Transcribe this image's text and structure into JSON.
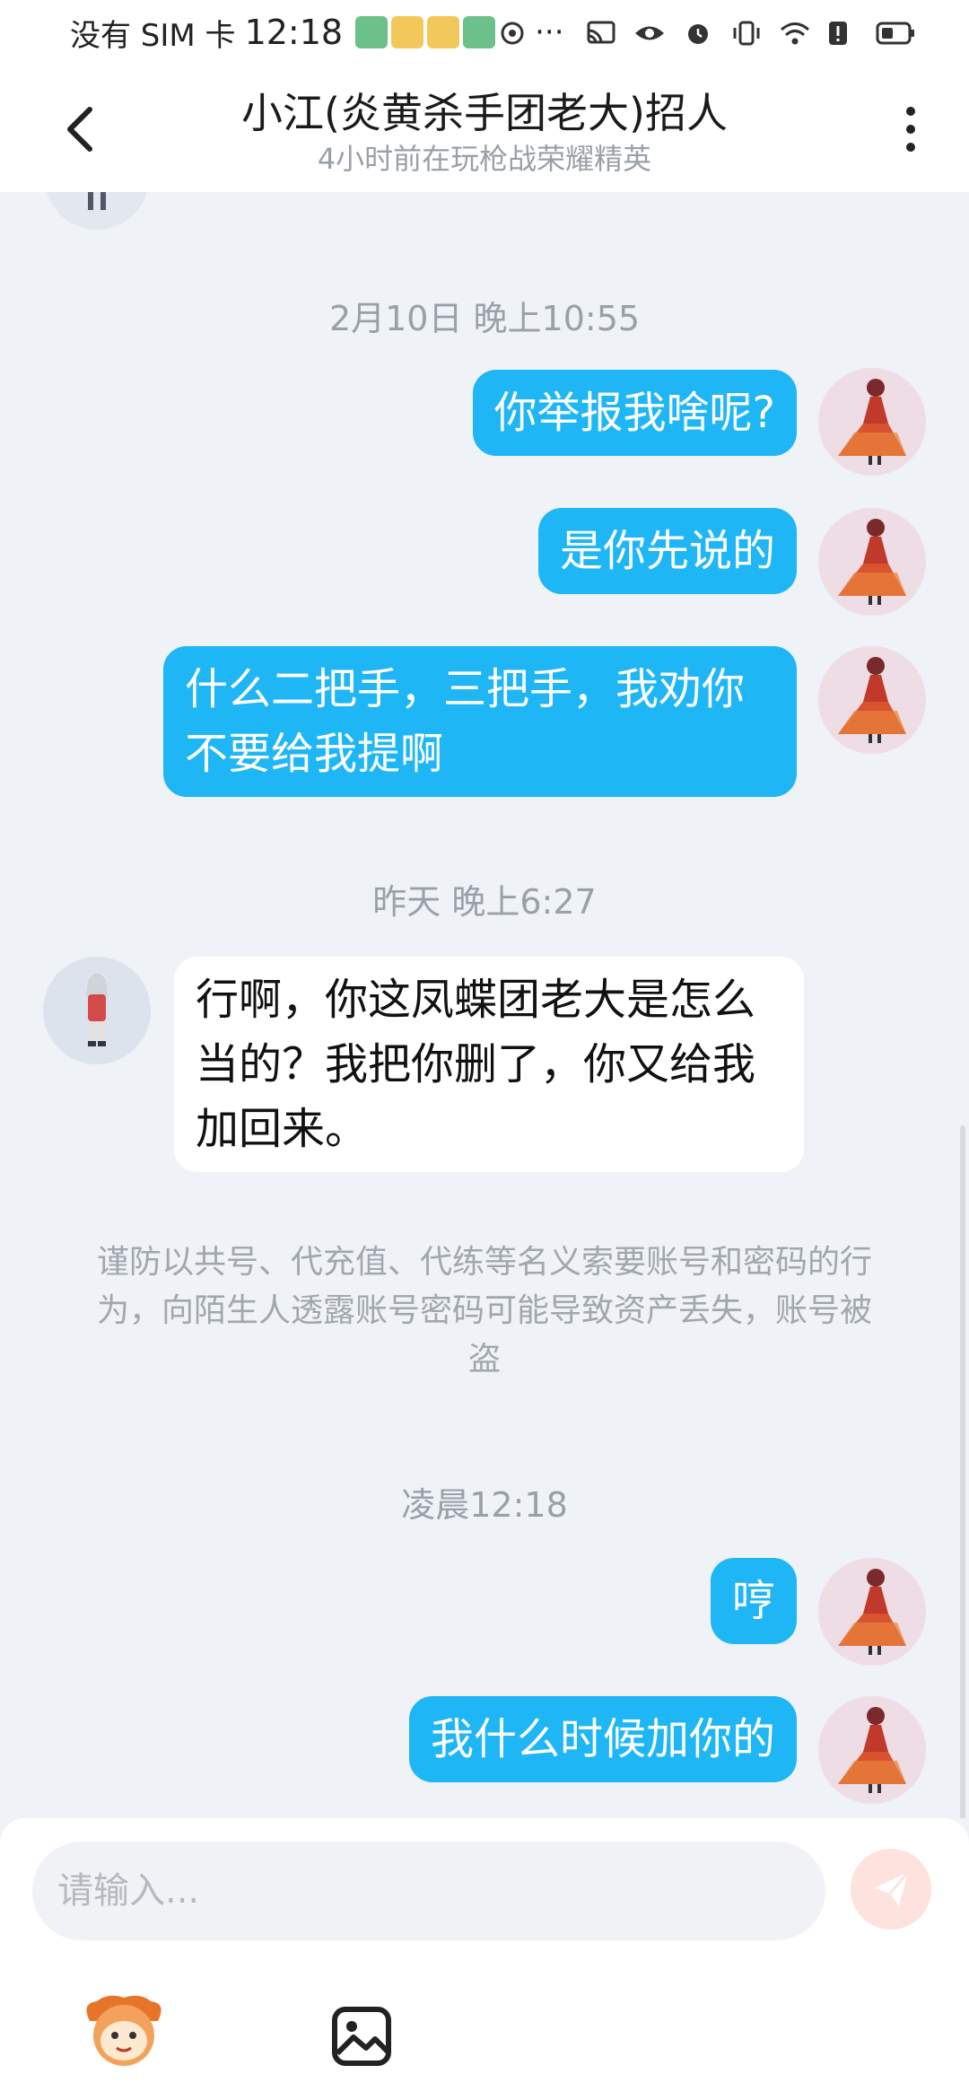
{
  "status_bar": {
    "carrier": "没有 SIM 卡",
    "time": "12:18",
    "more": "···",
    "icons": [
      "cast-icon",
      "eye-icon",
      "alarm-icon",
      "vibrate-icon",
      "wifi-icon",
      "alert-icon",
      "battery-icon"
    ]
  },
  "header": {
    "back_icon": "chevron-left-icon",
    "title": "小江(炎黄杀手团老大)招人",
    "subtitle": "4小时前在玩枪战荣耀精英",
    "more_icon": "more-vertical-icon"
  },
  "timestamps": [
    "2月10日 晚上10:55",
    "昨天 晚上6:27",
    "凌晨12:18"
  ],
  "messages": [
    {
      "from": "me",
      "text": "你举报我啥呢?"
    },
    {
      "from": "me",
      "text": "是你先说的"
    },
    {
      "from": "me",
      "text": "什么二把手，三把手，我劝你不要给我提啊"
    },
    {
      "from": "other",
      "text": "行啊，你这凤蝶团老大是怎么当的？我把你删了，你又给我加回来。"
    },
    {
      "from": "me",
      "text": "哼"
    },
    {
      "from": "me",
      "text": "我什么时候加你的"
    }
  ],
  "notice": "谨防以共号、代充值、代练等名义索要账号和密码的行为，向陌生人透露账号密码可能导致资产丢失，账号被盗",
  "input": {
    "placeholder": "请输入...",
    "send_icon": "send-icon",
    "emoji_icon": "mascot-emoji-icon",
    "image_icon": "image-icon"
  },
  "colors": {
    "my_bubble": "#1fb6f5",
    "other_bubble": "#ffffff",
    "background": "#eff2f7",
    "send_button": "#fde2dd"
  }
}
